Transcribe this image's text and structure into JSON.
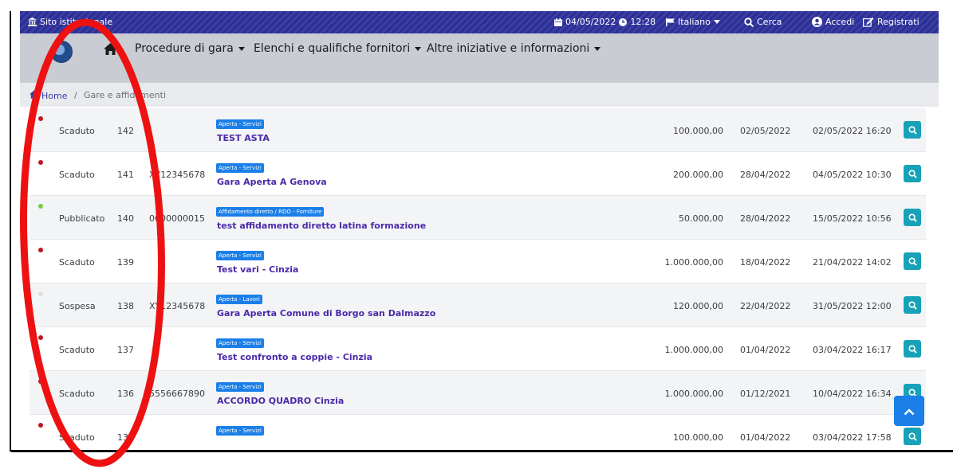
{
  "topbar": {
    "institutional_label": "Sito istituzionale",
    "date": "04/05/2022",
    "time": "12:28",
    "language": "Italiano",
    "search_label": "Cerca",
    "login_label": "Accedi",
    "register_label": "Registrati"
  },
  "nav": {
    "items": [
      {
        "label": "Procedure di gara"
      },
      {
        "label": "Elenchi e qualifiche fornitori"
      },
      {
        "label": "Altre iniziative e informazioni"
      }
    ]
  },
  "breadcrumb": {
    "home": "Home",
    "separator": "/",
    "current": "Gare e affidamenti"
  },
  "rows": [
    {
      "status": "Scaduto",
      "status_color": "#c0161e",
      "number": "142",
      "code": "",
      "badge": "Aperta - Servizi",
      "title": "TEST ASTA",
      "amount": "100.000,00",
      "date": "02/05/2022",
      "deadline": "02/05/2022 16:20"
    },
    {
      "status": "Scaduto",
      "status_color": "#c0161e",
      "number": "141",
      "code": "XY12345678",
      "badge": "Aperta - Servizi",
      "title": "Gara Aperta A Genova",
      "amount": "200.000,00",
      "date": "28/04/2022",
      "deadline": "04/05/2022 10:30"
    },
    {
      "status": "Pubblicato",
      "status_color": "#7ac943",
      "number": "140",
      "code": "0000000015",
      "badge": "Affidamento diretto / RDO - Forniture",
      "title": "test affidamento diretto latina formazione",
      "amount": "50.000,00",
      "date": "28/04/2022",
      "deadline": "15/05/2022 10:56"
    },
    {
      "status": "Scaduto",
      "status_color": "#c0161e",
      "number": "139",
      "code": "",
      "badge": "Aperta - Servizi",
      "title": "Test vari - Cinzia",
      "amount": "1.000.000,00",
      "date": "18/04/2022",
      "deadline": "21/04/2022 14:02"
    },
    {
      "status": "Sospesa",
      "status_color": "#e0e0e0",
      "number": "138",
      "code": "XY12345678",
      "badge": "Aperta - Lavori",
      "title": "Gara Aperta Comune di Borgo san Dalmazzo",
      "amount": "120.000,00",
      "date": "22/04/2022",
      "deadline": "31/05/2022 12:00"
    },
    {
      "status": "Scaduto",
      "status_color": "#c0161e",
      "number": "137",
      "code": "",
      "badge": "Aperta - Servizi",
      "title": "Test confronto a coppie - Cinzia",
      "amount": "1.000.000,00",
      "date": "01/04/2022",
      "deadline": "03/04/2022 16:17"
    },
    {
      "status": "Scaduto",
      "status_color": "#c0161e",
      "number": "136",
      "code": "5556667890",
      "badge": "Aperta - Servizi",
      "title": "ACCORDO QUADRO Cinzia",
      "amount": "1.000.000,00",
      "date": "01/12/2021",
      "deadline": "10/04/2022 16:34"
    },
    {
      "status": "Scaduto",
      "status_color": "#c0161e",
      "number": "134",
      "code": "",
      "badge": "Aperta - Servizi",
      "title": "",
      "amount": "100.000,00",
      "date": "01/04/2022",
      "deadline": "03/04/2022 17:58"
    }
  ],
  "colors": {
    "annotation": "#ee1111",
    "accent": "#17a2b8",
    "badge": "#1a7fe8",
    "title": "#4b2aa8"
  },
  "icons": {
    "institution": "bank-icon",
    "calendar": "calendar-icon",
    "clock": "clock-icon",
    "flag": "flag-icon",
    "search": "search-icon",
    "user": "user-circle-icon",
    "register": "edit-icon",
    "home": "home-icon",
    "view": "search-icon",
    "back_to_top": "chevron-up-icon"
  }
}
